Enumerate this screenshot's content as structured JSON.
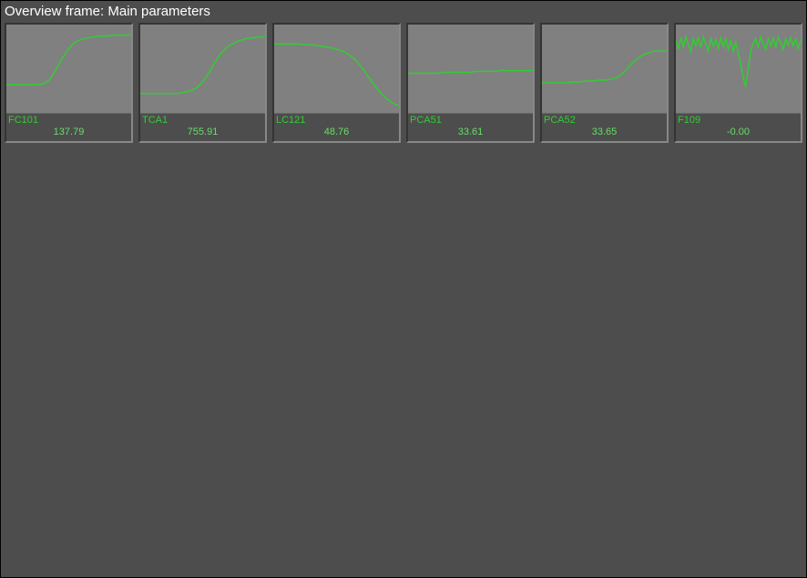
{
  "title": "Overview frame: Main parameters",
  "colors": {
    "line": "#33cc33",
    "footer_label": "#33cc33",
    "footer_value": "#66dd66"
  },
  "tiles": [
    {
      "label": "FC101",
      "value": "137.79"
    },
    {
      "label": "TCA1",
      "value": "755.91"
    },
    {
      "label": "LC121",
      "value": "48.76"
    },
    {
      "label": "PCA51",
      "value": "33.61"
    },
    {
      "label": "PCA52",
      "value": "33.65"
    },
    {
      "label": "F109",
      "value": "-0.00"
    }
  ],
  "chart_data": [
    {
      "type": "line",
      "tile": "FC101",
      "x": [
        0,
        5,
        10,
        15,
        20,
        25,
        30,
        35,
        40,
        45,
        50,
        55,
        60,
        65,
        70,
        75,
        80,
        85,
        90,
        95,
        100
      ],
      "y": [
        68,
        68,
        68,
        68,
        68,
        68,
        67,
        62,
        50,
        38,
        27,
        20,
        17,
        15,
        14,
        13,
        13,
        12,
        12,
        12,
        12
      ],
      "ylim": [
        0,
        100
      ],
      "xlim": [
        0,
        100
      ]
    },
    {
      "type": "line",
      "tile": "TCA1",
      "x": [
        0,
        5,
        10,
        15,
        20,
        25,
        30,
        35,
        40,
        45,
        50,
        55,
        60,
        65,
        70,
        75,
        80,
        85,
        90,
        95,
        100
      ],
      "y": [
        78,
        78,
        78,
        78,
        78,
        78,
        78,
        77,
        75,
        72,
        65,
        55,
        42,
        32,
        25,
        21,
        18,
        16,
        15,
        14,
        14
      ],
      "ylim": [
        0,
        100
      ],
      "xlim": [
        0,
        100
      ]
    },
    {
      "type": "line",
      "tile": "LC121",
      "x": [
        0,
        5,
        10,
        15,
        20,
        25,
        30,
        35,
        40,
        45,
        50,
        55,
        60,
        65,
        70,
        75,
        80,
        85,
        90,
        95,
        100
      ],
      "y": [
        22,
        22,
        22,
        22,
        22,
        23,
        23,
        24,
        25,
        26,
        28,
        30,
        34,
        40,
        48,
        58,
        68,
        77,
        84,
        89,
        92
      ],
      "ylim": [
        0,
        100
      ],
      "xlim": [
        0,
        100
      ]
    },
    {
      "type": "line",
      "tile": "PCA51",
      "x": [
        0,
        5,
        10,
        15,
        20,
        25,
        30,
        35,
        40,
        45,
        50,
        55,
        60,
        65,
        70,
        75,
        80,
        85,
        90,
        95,
        100
      ],
      "y": [
        55,
        55,
        55,
        55,
        55,
        55,
        54,
        54,
        54,
        54,
        54,
        53,
        53,
        53,
        53,
        52,
        52,
        52,
        52,
        52,
        52
      ],
      "ylim": [
        0,
        100
      ],
      "xlim": [
        0,
        100
      ]
    },
    {
      "type": "line",
      "tile": "PCA52",
      "x": [
        0,
        5,
        10,
        15,
        20,
        25,
        30,
        35,
        40,
        45,
        50,
        55,
        60,
        65,
        70,
        75,
        80,
        85,
        90,
        95,
        100
      ],
      "y": [
        66,
        66,
        66,
        66,
        66,
        65,
        65,
        64,
        64,
        63,
        63,
        62,
        60,
        55,
        47,
        40,
        35,
        32,
        30,
        30,
        30
      ],
      "ylim": [
        0,
        100
      ],
      "xlim": [
        0,
        100
      ]
    },
    {
      "type": "line",
      "tile": "F109",
      "x": [
        0,
        2,
        4,
        6,
        8,
        10,
        12,
        14,
        16,
        18,
        20,
        22,
        24,
        26,
        28,
        30,
        32,
        34,
        36,
        38,
        40,
        42,
        44,
        46,
        48,
        50,
        52,
        54,
        56,
        58,
        60,
        62,
        64,
        66,
        68,
        70,
        72,
        74,
        76,
        78,
        80,
        82,
        84,
        86,
        88,
        90,
        92,
        94,
        96,
        98,
        100
      ],
      "y": [
        18,
        28,
        15,
        25,
        14,
        22,
        30,
        16,
        24,
        15,
        26,
        14,
        22,
        30,
        16,
        24,
        17,
        27,
        15,
        25,
        16,
        28,
        18,
        30,
        20,
        32,
        45,
        60,
        70,
        50,
        30,
        22,
        16,
        25,
        14,
        22,
        28,
        16,
        24,
        15,
        26,
        14,
        20,
        28,
        16,
        23,
        15,
        24,
        16,
        27,
        18
      ],
      "ylim": [
        0,
        100
      ],
      "xlim": [
        0,
        100
      ]
    }
  ]
}
